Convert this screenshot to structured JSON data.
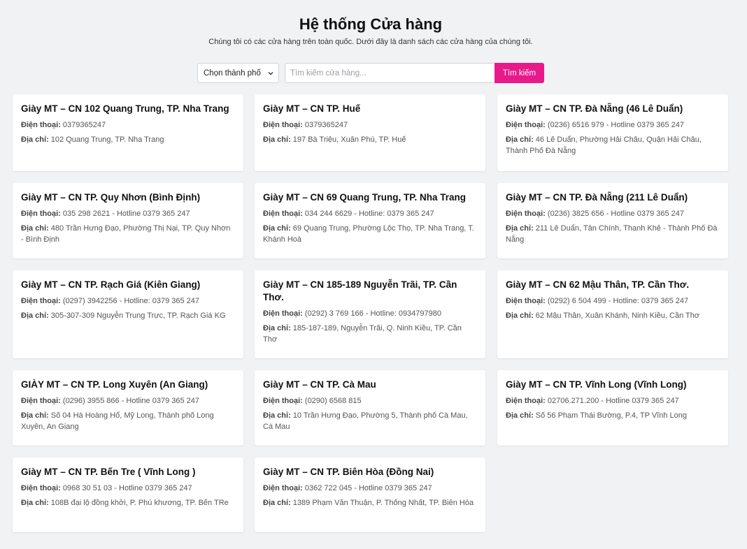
{
  "header": {
    "title": "Hệ thống Cửa hàng",
    "subtitle": "Chúng tôi có các cửa hàng trên toàn quốc. Dưới đây là danh sách các cửa hàng của chúng tôi."
  },
  "filter": {
    "city_select_value": "Chọn thành phố",
    "search_placeholder": "Tìm kiếm cửa hàng...",
    "search_button": "Tìm kiếm"
  },
  "labels": {
    "phone": "Điện thoại:",
    "address": "Địa chỉ:"
  },
  "stores": [
    {
      "name": "Giày MT – CN 102 Quang Trung, TP. Nha Trang",
      "phone": "0379365247",
      "address": "102 Quang Trung, TP. Nha Trang"
    },
    {
      "name": "Giày MT – CN TP. Huế",
      "phone": "0379365247",
      "address": "197 Bà Triệu, Xuân Phú, TP. Huế"
    },
    {
      "name": "Giày MT – CN TP. Đà Nẵng (46 Lê Duẩn)",
      "phone": "(0236) 6516 979 - Hotline 0379 365 247",
      "address": "46 Lê Duẩn, Phường Hải Châu, Quận Hải Châu, Thành Phố Đà Nẵng"
    },
    {
      "name": "Giày MT – CN TP. Quy Nhơn (Bình Định)",
      "phone": "035 298 2621 - Hotline 0379 365 247",
      "address": "480 Trần Hưng Đạo, Phường Thị Nại, TP. Quy Nhơn - Bình Định"
    },
    {
      "name": "Giày MT – CN 69 Quang Trung, TP. Nha Trang",
      "phone": "034 244 6629 - Hotline: 0379 365 247",
      "address": "69 Quang Trung, Phường Lộc Thọ, TP. Nha Trang, T. Khánh Hoà"
    },
    {
      "name": "Giày MT – CN TP. Đà Nẵng (211 Lê Duẩn)",
      "phone": "(0236) 3825 656 - Hotline 0379 365 247",
      "address": "211 Lê Duẩn, Tân Chính, Thanh Khê - Thành Phố Đà Nẵng"
    },
    {
      "name": "Giày MT – CN TP. Rạch Giá (Kiên Giang)",
      "phone": "(0297) 3942256 - Hotline: 0379 365 247",
      "address": "305-307-309 Nguyễn Trung Trực, TP. Rạch Giá KG"
    },
    {
      "name": "Giày MT – CN 185-189 Nguyễn Trãi, TP. Cần Thơ.",
      "phone": "(0292) 3 769 166 - Hotline: 0934797980",
      "address": "185-187-189, Nguyễn Trãi, Q. Ninh Kiều, TP. Cần Thơ"
    },
    {
      "name": "Giày MT – CN 62 Mậu Thân, TP. Cần Thơ.",
      "phone": "(0292) 6 504 499 - Hotline: 0379 365 247",
      "address": "62 Mậu Thân, Xuân Khánh, Ninh Kiều, Cần Thơ"
    },
    {
      "name": "GIÀY MT – CN TP. Long Xuyên (An Giang)",
      "phone": "(0296) 3955 866 - Hotline 0379 365 247",
      "address": "Số 04 Hà Hoàng Hổ, Mỹ Long, Thành phố Long Xuyên, An Giang"
    },
    {
      "name": "Giày MT – CN TP. Cà Mau",
      "phone": "(0290) 6568 815",
      "address": "10 Trần Hưng Đạo, Phường 5, Thành phố Cà Mau, Cà Mau"
    },
    {
      "name": "Giày MT – CN TP. Vĩnh Long (Vĩnh Long)",
      "phone": "02706.271.200 - Hotline 0379 365 247",
      "address": "Số 56 Phạm Thái Bường, P.4, TP Vĩnh Long"
    },
    {
      "name": "Giày MT – CN TP. Bến Tre ( Vĩnh Long )",
      "phone": "0968 30 51 03 - Hotline 0379 365 247",
      "address": "108B đại lộ đồng khởi, P. Phú khương, TP. Bến TRe"
    },
    {
      "name": "Giày MT – CN TP. Biên Hòa (Đồng Nai)",
      "phone": "0362 722 045 - Hotline 0379 365 247",
      "address": "1389 Phạm Văn Thuận, P. Thống Nhất, TP. Biên Hòa"
    }
  ]
}
